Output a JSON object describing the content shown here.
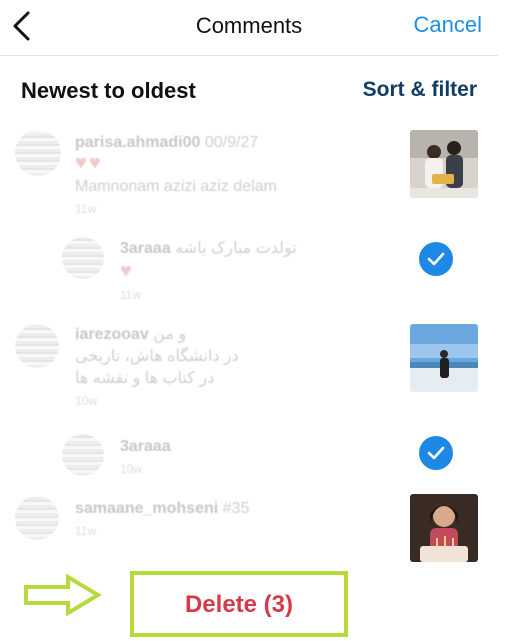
{
  "header": {
    "title": "Comments",
    "cancel_label": "Cancel"
  },
  "sort": {
    "label": "Newest to oldest",
    "filter_label": "Sort & filter"
  },
  "comments": [
    {
      "username": "parisa.ahmadi00",
      "text_inline": "00/9/27",
      "hearts": "♥♥",
      "text": "Mamnonam azizi aziz delam",
      "time": "11w"
    },
    {
      "username": "3araaa",
      "text_inline": "تولدت مبارک باشه",
      "hearts": "♥",
      "text": "",
      "time": "11w"
    },
    {
      "username": "iarezooav",
      "text_inline": "و من",
      "text": "در دانشگاه هاش، تاریخی",
      "text2": "در کتاب ها و نقشه ها",
      "time": "10w"
    },
    {
      "username": "3araaa",
      "text_inline": "",
      "text": "",
      "time": "10w"
    },
    {
      "username": "samaane_mohseni",
      "text_inline": "#35",
      "text": "",
      "time": "11w"
    }
  ],
  "bottom": {
    "delete_label": "Delete (3)"
  },
  "colors": {
    "accent": "#1f8fe0",
    "check": "#1e88e5",
    "delete": "#d43a4a",
    "highlight": "#b6d93b"
  }
}
